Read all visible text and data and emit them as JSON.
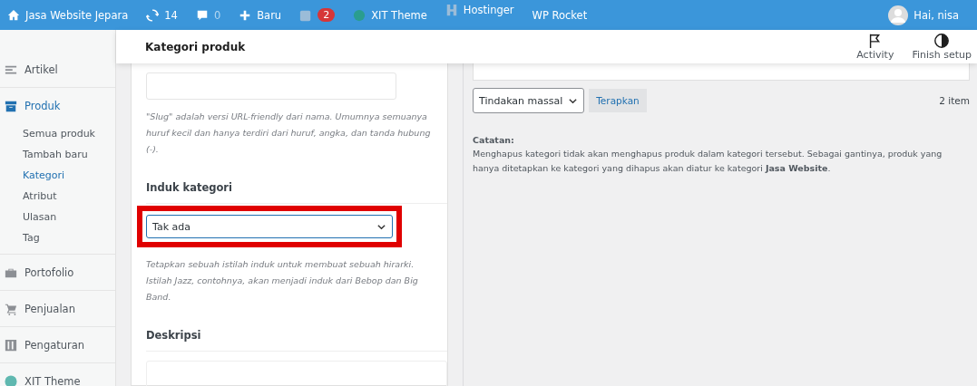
{
  "admin_bar": {
    "site": "Jasa Website Jepara",
    "updates": "14",
    "comments": "0",
    "new": "Baru",
    "seo_badge": "2",
    "theme": "XIT Theme",
    "hosting": "Hostinger",
    "cache": "WP Rocket",
    "greeting": "Hai, nisa"
  },
  "header": {
    "title": "Kategori produk",
    "actions": [
      {
        "kind": "flag",
        "label": "Activity"
      },
      {
        "kind": "contrast",
        "label": "Finish setup"
      }
    ]
  },
  "sidebar": {
    "items": [
      {
        "kind": "list",
        "label": "Artikel",
        "selected": false
      },
      {
        "kind": "box",
        "label": "Produk",
        "selected": true,
        "children": [
          {
            "label": "Semua produk",
            "selected": false
          },
          {
            "label": "Tambah baru",
            "selected": false
          },
          {
            "label": "Kategori",
            "selected": true
          },
          {
            "label": "Atribut",
            "selected": false
          },
          {
            "label": "Ulasan",
            "selected": false
          },
          {
            "label": "Tag",
            "selected": false
          }
        ]
      },
      {
        "kind": "briefcase",
        "label": "Portofolio",
        "selected": false
      },
      {
        "kind": "cart",
        "label": "Penjualan",
        "selected": false
      },
      {
        "kind": "sliders",
        "label": "Pengaturan",
        "selected": false
      },
      {
        "kind": "theme",
        "label": "XIT Theme",
        "selected": false
      }
    ]
  },
  "form": {
    "slug_hint": "\"Slug\" adalah versi URL-friendly dari nama. Umumnya semuanya huruf kecil dan hanya terdiri dari huruf, angka, dan tanda hubung (-).",
    "parent": {
      "label": "Induk kategori",
      "value": "Tak ada",
      "highlighted": true,
      "hint": "Tetapkan sebuah istilah induk untuk membuat sebuah hirarki. Istilah Jazz, contohnya, akan menjadi induk dari Bebop dan Big Band."
    },
    "description": {
      "label": "Deskripsi"
    }
  },
  "list": {
    "bulk_action": "Tindakan massal",
    "apply": "Terapkan",
    "count": "2 item",
    "note_title": "Catatan:",
    "note": "Menghapus kategori tidak akan menghapus produk dalam kategori tersebut. Sebagai gantinya, produk yang hanya ditetapkan ke kategori yang dihapus akan diatur ke kategori **Jasa Website**."
  }
}
